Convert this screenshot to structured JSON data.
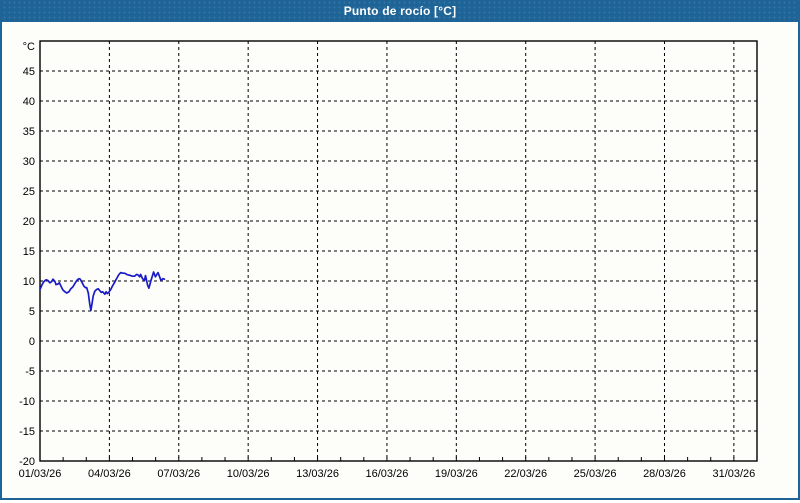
{
  "accent_color": "#1e6497",
  "page_bg": "#fdfef9",
  "chart_data": {
    "type": "line",
    "title": "Punto de rocío [°C]",
    "xlabel": "",
    "ylabel": "",
    "xlim_days": [
      0,
      31
    ],
    "ylim": [
      -20,
      50
    ],
    "grid": "dashed",
    "grid_color": "#000000",
    "axis_color": "#000000",
    "y_axis": {
      "unit_label": "°C",
      "unit_label_value": 50,
      "tick_values": [
        -20,
        -15,
        -10,
        -5,
        0,
        5,
        10,
        15,
        20,
        25,
        30,
        35,
        40,
        45
      ],
      "tick_labels": [
        "-20",
        "-15",
        "-10",
        "-5",
        "0",
        "5",
        "10",
        "15",
        "20",
        "25",
        "30",
        "35",
        "40",
        "45"
      ],
      "gridline_values": [
        -15,
        -10,
        -5,
        0,
        5,
        10,
        15,
        20,
        25,
        30,
        35,
        40,
        45
      ]
    },
    "x_axis": {
      "minor_tick_every_days": 1,
      "ticks": [
        {
          "day": 0,
          "label": "01/03/26"
        },
        {
          "day": 3,
          "label": "04/03/26"
        },
        {
          "day": 6,
          "label": "07/03/26"
        },
        {
          "day": 9,
          "label": "10/03/26"
        },
        {
          "day": 12,
          "label": "13/03/26"
        },
        {
          "day": 15,
          "label": "16/03/26"
        },
        {
          "day": 18,
          "label": "19/03/26"
        },
        {
          "day": 21,
          "label": "22/03/26"
        },
        {
          "day": 24,
          "label": "25/03/26"
        },
        {
          "day": 27,
          "label": "28/03/26"
        },
        {
          "day": 30,
          "label": "31/03/26"
        }
      ]
    },
    "series": [
      {
        "name": "Punto de rocío",
        "color": "#1a1ac8",
        "points": [
          [
            0.0,
            8.6
          ],
          [
            0.09,
            9.4
          ],
          [
            0.17,
            9.9
          ],
          [
            0.26,
            10.2
          ],
          [
            0.34,
            10.1
          ],
          [
            0.43,
            9.7
          ],
          [
            0.5,
            9.9
          ],
          [
            0.56,
            10.3
          ],
          [
            0.65,
            9.9
          ],
          [
            0.69,
            9.4
          ],
          [
            0.78,
            9.5
          ],
          [
            0.84,
            9.7
          ],
          [
            0.9,
            9.2
          ],
          [
            0.99,
            8.5
          ],
          [
            1.08,
            8.2
          ],
          [
            1.16,
            8.0
          ],
          [
            1.25,
            8.2
          ],
          [
            1.33,
            8.7
          ],
          [
            1.42,
            9.0
          ],
          [
            1.51,
            9.6
          ],
          [
            1.59,
            10.1
          ],
          [
            1.68,
            10.4
          ],
          [
            1.74,
            10.3
          ],
          [
            1.81,
            9.8
          ],
          [
            1.89,
            9.2
          ],
          [
            1.96,
            8.9
          ],
          [
            2.02,
            8.9
          ],
          [
            2.09,
            8.0
          ],
          [
            2.15,
            6.2
          ],
          [
            2.2,
            5.1
          ],
          [
            2.24,
            6.0
          ],
          [
            2.3,
            7.5
          ],
          [
            2.37,
            8.3
          ],
          [
            2.45,
            8.6
          ],
          [
            2.52,
            8.7
          ],
          [
            2.58,
            8.4
          ],
          [
            2.65,
            8.1
          ],
          [
            2.71,
            8.2
          ],
          [
            2.8,
            7.8
          ],
          [
            2.86,
            8.2
          ],
          [
            2.91,
            7.9
          ],
          [
            2.97,
            8.1
          ],
          [
            3.06,
            8.6
          ],
          [
            3.14,
            9.2
          ],
          [
            3.23,
            9.8
          ],
          [
            3.31,
            10.4
          ],
          [
            3.4,
            11.0
          ],
          [
            3.49,
            11.4
          ],
          [
            3.57,
            11.3
          ],
          [
            3.66,
            11.3
          ],
          [
            3.75,
            11.1
          ],
          [
            3.83,
            11.0
          ],
          [
            3.92,
            10.9
          ],
          [
            4.0,
            10.8
          ],
          [
            4.09,
            10.8
          ],
          [
            4.18,
            11.1
          ],
          [
            4.24,
            11.0
          ],
          [
            4.31,
            10.7
          ],
          [
            4.35,
            11.1
          ],
          [
            4.43,
            10.4
          ],
          [
            4.52,
            10.1
          ],
          [
            4.56,
            10.9
          ],
          [
            4.65,
            9.3
          ],
          [
            4.71,
            8.8
          ],
          [
            4.8,
            10.1
          ],
          [
            4.91,
            11.5
          ],
          [
            4.99,
            10.7
          ],
          [
            5.1,
            11.4
          ],
          [
            5.23,
            10.1
          ],
          [
            5.32,
            10.4
          ],
          [
            5.38,
            10.3
          ]
        ]
      }
    ]
  }
}
